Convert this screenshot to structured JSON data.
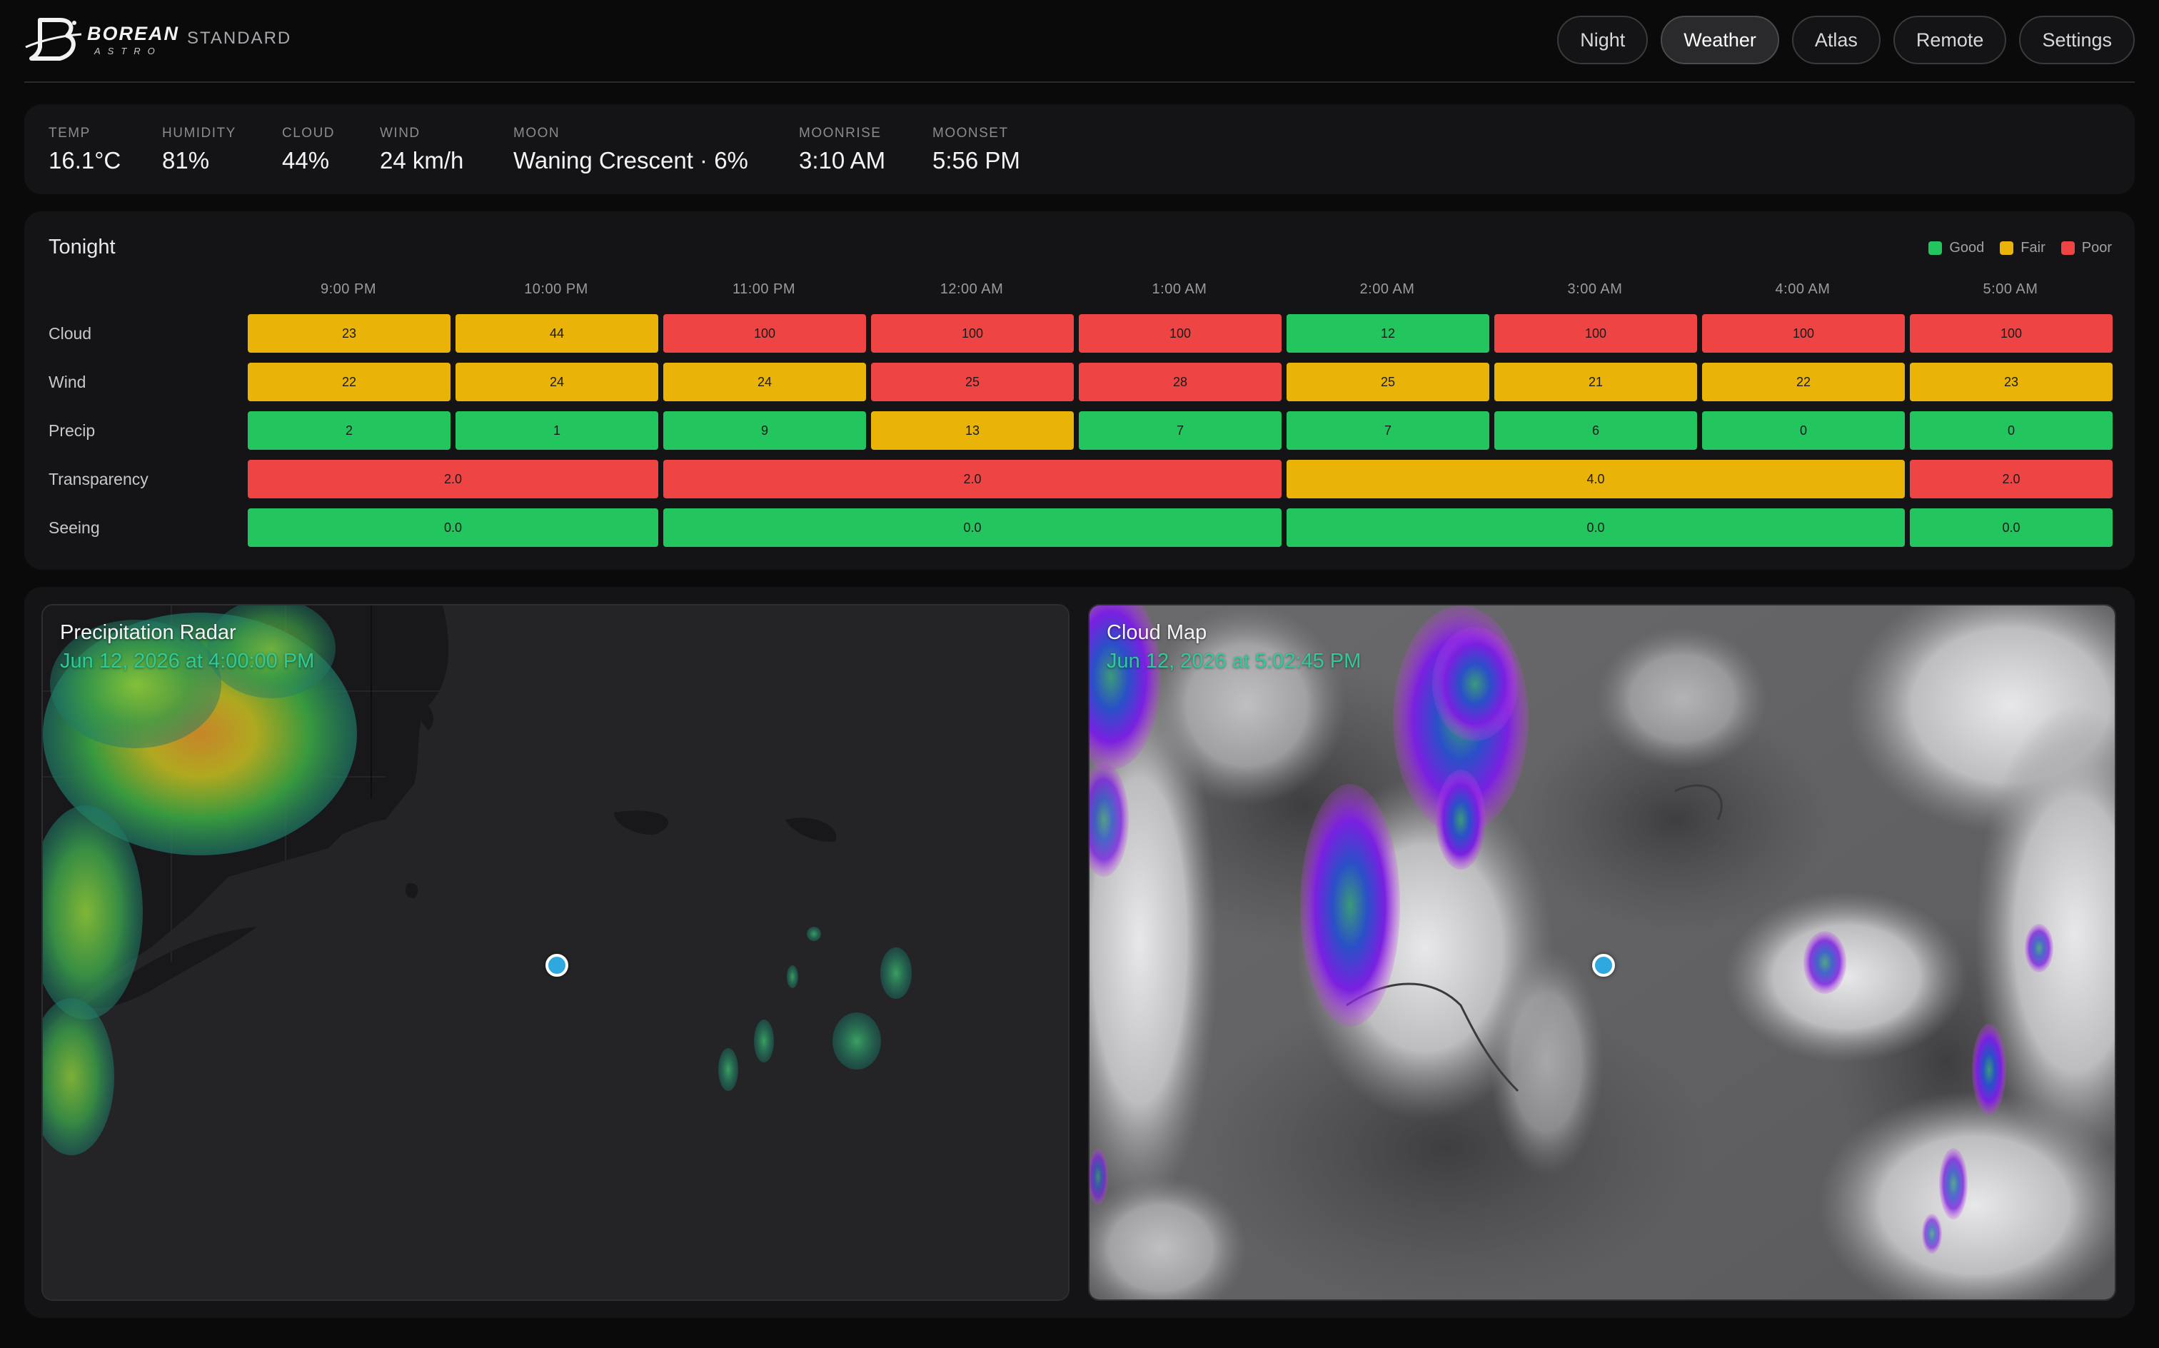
{
  "app": {
    "brand": "BOREAN",
    "brand_sub": "ASTRO",
    "mode": "STANDARD"
  },
  "nav": [
    {
      "label": "Night",
      "active": false
    },
    {
      "label": "Weather",
      "active": true
    },
    {
      "label": "Atlas",
      "active": false
    },
    {
      "label": "Remote",
      "active": false
    },
    {
      "label": "Settings",
      "active": false
    }
  ],
  "conditions": [
    {
      "label": "TEMP",
      "value": "16.1°C"
    },
    {
      "label": "HUMIDITY",
      "value": "81%"
    },
    {
      "label": "CLOUD",
      "value": "44%"
    },
    {
      "label": "WIND",
      "value": "24 km/h"
    },
    {
      "label": "MOON",
      "value": "Waning Crescent · 6%"
    },
    {
      "label": "MOONRISE",
      "value": "3:10 AM"
    },
    {
      "label": "MOONSET",
      "value": "5:56 PM"
    }
  ],
  "tonight": {
    "title": "Tonight",
    "legend": [
      {
        "label": "Good",
        "color": "#22c55e"
      },
      {
        "label": "Fair",
        "color": "#eab308"
      },
      {
        "label": "Poor",
        "color": "#ef4444"
      }
    ],
    "hours": [
      "9:00 PM",
      "10:00 PM",
      "11:00 PM",
      "12:00 AM",
      "1:00 AM",
      "2:00 AM",
      "3:00 AM",
      "4:00 AM",
      "5:00 AM"
    ],
    "rows": [
      {
        "label": "Cloud",
        "cells": [
          {
            "value": "23",
            "span": 1,
            "rating": "fair"
          },
          {
            "value": "44",
            "span": 1,
            "rating": "fair"
          },
          {
            "value": "100",
            "span": 1,
            "rating": "poor"
          },
          {
            "value": "100",
            "span": 1,
            "rating": "poor"
          },
          {
            "value": "100",
            "span": 1,
            "rating": "poor"
          },
          {
            "value": "12",
            "span": 1,
            "rating": "good"
          },
          {
            "value": "100",
            "span": 1,
            "rating": "poor"
          },
          {
            "value": "100",
            "span": 1,
            "rating": "poor"
          },
          {
            "value": "100",
            "span": 1,
            "rating": "poor"
          }
        ]
      },
      {
        "label": "Wind",
        "cells": [
          {
            "value": "22",
            "span": 1,
            "rating": "fair"
          },
          {
            "value": "24",
            "span": 1,
            "rating": "fair"
          },
          {
            "value": "24",
            "span": 1,
            "rating": "fair"
          },
          {
            "value": "25",
            "span": 1,
            "rating": "poor"
          },
          {
            "value": "28",
            "span": 1,
            "rating": "poor"
          },
          {
            "value": "25",
            "span": 1,
            "rating": "fair"
          },
          {
            "value": "21",
            "span": 1,
            "rating": "fair"
          },
          {
            "value": "22",
            "span": 1,
            "rating": "fair"
          },
          {
            "value": "23",
            "span": 1,
            "rating": "fair"
          }
        ]
      },
      {
        "label": "Precip",
        "cells": [
          {
            "value": "2",
            "span": 1,
            "rating": "good"
          },
          {
            "value": "1",
            "span": 1,
            "rating": "good"
          },
          {
            "value": "9",
            "span": 1,
            "rating": "good"
          },
          {
            "value": "13",
            "span": 1,
            "rating": "fair"
          },
          {
            "value": "7",
            "span": 1,
            "rating": "good"
          },
          {
            "value": "7",
            "span": 1,
            "rating": "good"
          },
          {
            "value": "6",
            "span": 1,
            "rating": "good"
          },
          {
            "value": "0",
            "span": 1,
            "rating": "good"
          },
          {
            "value": "0",
            "span": 1,
            "rating": "good"
          }
        ]
      },
      {
        "label": "Transparency",
        "cells": [
          {
            "value": "2.0",
            "span": 2,
            "rating": "poor"
          },
          {
            "value": "2.0",
            "span": 3,
            "rating": "poor"
          },
          {
            "value": "4.0",
            "span": 3,
            "rating": "fair"
          },
          {
            "value": "2.0",
            "span": 1,
            "rating": "poor"
          }
        ]
      },
      {
        "label": "Seeing",
        "cells": [
          {
            "value": "0.0",
            "span": 2,
            "rating": "good"
          },
          {
            "value": "0.0",
            "span": 3,
            "rating": "good"
          },
          {
            "value": "0.0",
            "span": 3,
            "rating": "good"
          },
          {
            "value": "0.0",
            "span": 1,
            "rating": "good"
          }
        ]
      }
    ]
  },
  "maps": {
    "radar": {
      "title": "Precipitation Radar",
      "timestamp": "Jun 12, 2026 at 4:00:00 PM"
    },
    "cloud": {
      "title": "Cloud Map",
      "timestamp": "Jun 12, 2026 at 5:02:45 PM"
    }
  },
  "colors": {
    "good": "#22c55e",
    "fair": "#eab308",
    "poor": "#ef4444",
    "accent": "#2fc99a",
    "location": "#2fa8e0"
  },
  "icons": {
    "location": "location-dot-icon",
    "logo": "borean-logo-icon"
  }
}
